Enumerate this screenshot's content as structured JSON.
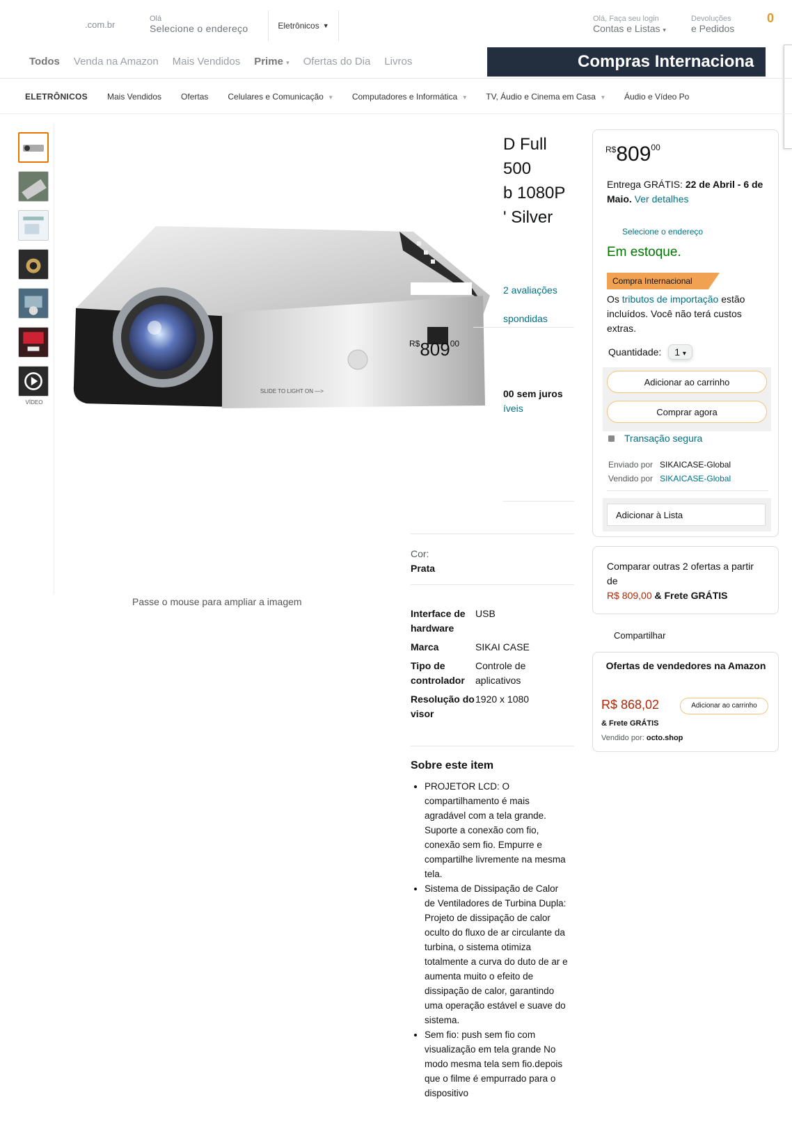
{
  "header": {
    "domain": ".com.br",
    "hello": "Olá",
    "select_address": "Selecione o endereço",
    "category": "Eletrônicos",
    "account_top": "Olá, Faça seu login",
    "account": "Contas e Listas",
    "returns_top": "Devoluções",
    "returns": "e Pedidos",
    "cart_count": "0"
  },
  "nav": {
    "items": [
      "Todos",
      "Venda na Amazon",
      "Mais Vendidos",
      "Prime",
      "Ofertas do Dia",
      "Livros"
    ],
    "banner": "Compras Internaciona"
  },
  "subnav": {
    "items": [
      "ELETRÔNICOS",
      "Mais Vendidos",
      "Ofertas",
      "Celulares e Comunicação",
      "Computadores e Informática",
      "TV, Áudio e Cinema em Casa",
      "Áudio e Vídeo Po"
    ]
  },
  "gallery": {
    "video_label": "VÍDEO",
    "hover_text": "Passe o mouse para ampliar a imagem",
    "image_price": "809",
    "image_price_cur": "R$",
    "image_price_cents": "00",
    "image_label": "SLIDE TO LIGHT ON  —>"
  },
  "title": {
    "lines": [
      "D Full",
      "500",
      "b 1080P",
      "' Silver"
    ],
    "ratings": "2 avaliações",
    "answered": "spondidas",
    "installments": "00 sem juros",
    "available": "íveis"
  },
  "options": {
    "color_label": "Cor:",
    "color_value": "Prata"
  },
  "specs": [
    {
      "k": "Interface de hardware",
      "v": "USB"
    },
    {
      "k": "Marca",
      "v": "SIKAI CASE"
    },
    {
      "k": "Tipo de controlador",
      "v": "Controle de aplicativos"
    },
    {
      "k": "Resolução do visor",
      "v": "1920 x 1080"
    }
  ],
  "about": {
    "heading": "Sobre este item",
    "items": [
      "PROJETOR LCD: O compartilhamento é mais agradável com a tela grande. Suporte a conexão com fio, conexão sem fio. Empurre e compartilhe livremente na mesma tela.",
      "Sistema de Dissipação de Calor de Ventiladores de Turbina Dupla: Projeto de dissipação de calor oculto do fluxo de ar circulante da turbina, o sistema otimiza totalmente a curva do duto de ar e aumenta muito o efeito de dissipação de calor, garantindo uma operação estável e suave do sistema.",
      "Sem fio: push sem fio com visualização em tela grande No modo mesma tela sem fio.depois que o filme é empurrado para o dispositivo"
    ]
  },
  "buybox": {
    "currency": "R$",
    "price": "809",
    "cents": "00",
    "delivery_prefix": "Entrega GRÁTIS:",
    "delivery_date": "22 de Abril - 6 de Maio.",
    "delivery_link": "Ver detalhes",
    "select_address": "Selecione o endereço",
    "stock": "Em estoque.",
    "badge": "Compra Internacional",
    "tributes_pre": "Os",
    "tributes_link": "tributos de importação",
    "tributes_post": "estão incluídos. Você não terá custos extras.",
    "qty_label": "Quantidade:",
    "qty_value": "1",
    "add_to_cart": "Adicionar ao carrinho",
    "buy_now": "Comprar agora",
    "secure": "Transação segura",
    "shipped_by_label": "Enviado por",
    "shipped_by": "SIKAICASE-Global",
    "sold_by_label": "Vendido por",
    "sold_by": "SIKAICASE-Global",
    "add_to_list": "Adicionar à Lista"
  },
  "compare": {
    "text": "Comparar outras 2 ofertas a partir de",
    "price": "R$ 809,00",
    "shipping": "& Frete GRÁTIS"
  },
  "share": "Compartilhar",
  "offers": {
    "title": "Ofertas de vendedores na Amazon",
    "price": "R$ 868,02",
    "add_button": "Adicionar ao carrinho",
    "shipping": "& Frete GRÁTIS",
    "sold_label": "Vendido por:",
    "seller": "octo.shop"
  },
  "colors": {
    "accent": "#e77600",
    "link": "#007185",
    "stock": "#007600",
    "price_red": "#b12704",
    "banner": "#232f3e",
    "badge": "#f0a252"
  }
}
